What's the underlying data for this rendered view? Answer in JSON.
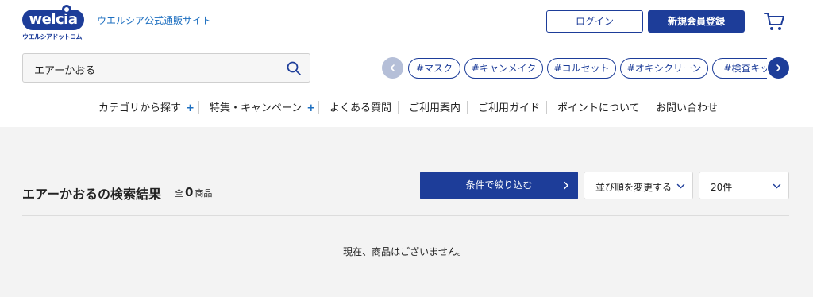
{
  "logo": {
    "wordmark": "welcia",
    "subtext": "ウエルシアドットコム"
  },
  "site_tagline": "ウエルシア公式通販サイト",
  "header_buttons": {
    "login": "ログイン",
    "register": "新規会員登録"
  },
  "icons": {
    "cart": "cart-icon",
    "search": "search-icon",
    "prev": "chevron-left-icon",
    "next": "chevron-right-icon",
    "dropdown": "chevron-down-icon"
  },
  "search": {
    "value": "エアーかおる"
  },
  "tags": [
    "#マスク",
    "#キャンメイク",
    "#コルセット",
    "#オキシクリーン",
    "#検査キット"
  ],
  "nav": {
    "items": [
      "カテゴリから探す",
      "特集・キャンペーン",
      "よくある質問",
      "ご利用案内",
      "ご利用ガイド",
      "ポイントについて",
      "お問い合わせ"
    ],
    "plus": "+"
  },
  "results": {
    "title": "エアーかおるの検索結果",
    "count_prefix": "全",
    "count": "0",
    "count_suffix": "商品",
    "empty_message": "現在、商品はございません。"
  },
  "controls": {
    "filter_button": "条件で絞り込む",
    "sort_select": "並び順を変更する",
    "per_page_select": "20件"
  },
  "colors": {
    "brand": "#1d3d99",
    "link": "#1d6fc0",
    "background": "#f3f3f3"
  }
}
